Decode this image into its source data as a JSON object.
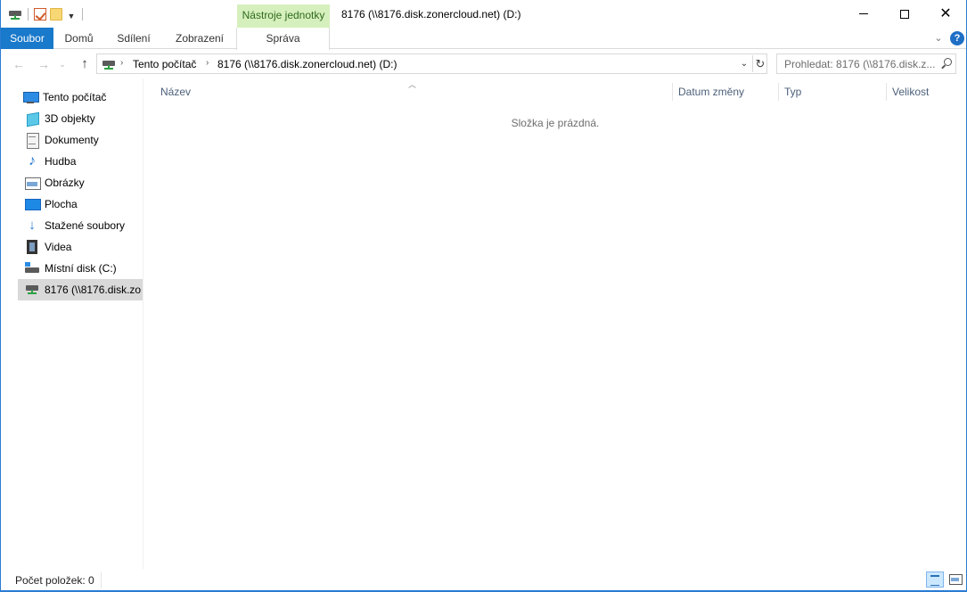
{
  "window": {
    "title": "8176 (\\\\8176.disk.zonercloud.net) (D:)",
    "accent_color": "#1979ca",
    "context_tab_color": "#d6f0bd"
  },
  "quick_access_toolbar": {
    "icons": [
      "network-drive-icon",
      "properties-icon",
      "new-folder-icon",
      "customize-dropdown-icon"
    ]
  },
  "ribbon": {
    "context_group": "Nástroje jednotky",
    "tabs": {
      "file": "Soubor",
      "home": "Domů",
      "share": "Sdílení",
      "view": "Zobrazení",
      "manage": "Správa"
    },
    "help": "?"
  },
  "address_bar": {
    "crumbs": [
      "Tento počítač",
      "8176 (\\\\8176.disk.zonercloud.net) (D:)"
    ]
  },
  "search": {
    "placeholder": "Prohledat: 8176 (\\\\8176.disk.z..."
  },
  "nav_pane": {
    "root": "Tento počítač",
    "items": [
      {
        "label": "3D objekty",
        "icon": "3d-objects-icon"
      },
      {
        "label": "Dokumenty",
        "icon": "documents-icon"
      },
      {
        "label": "Hudba",
        "icon": "music-icon"
      },
      {
        "label": "Obrázky",
        "icon": "pictures-icon"
      },
      {
        "label": "Plocha",
        "icon": "desktop-icon"
      },
      {
        "label": "Stažené soubory",
        "icon": "downloads-icon"
      },
      {
        "label": "Videa",
        "icon": "videos-icon"
      },
      {
        "label": "Místní disk (C:)",
        "icon": "local-disk-icon"
      },
      {
        "label": "8176 (\\\\8176.disk.zo",
        "icon": "network-drive-icon"
      }
    ],
    "selected_index": 8
  },
  "content": {
    "columns": {
      "name": "Název",
      "date": "Datum změny",
      "type": "Typ",
      "size": "Velikost"
    },
    "empty_message": "Složka je prázdná."
  },
  "statusbar": {
    "item_count": "Počet položek: 0"
  }
}
